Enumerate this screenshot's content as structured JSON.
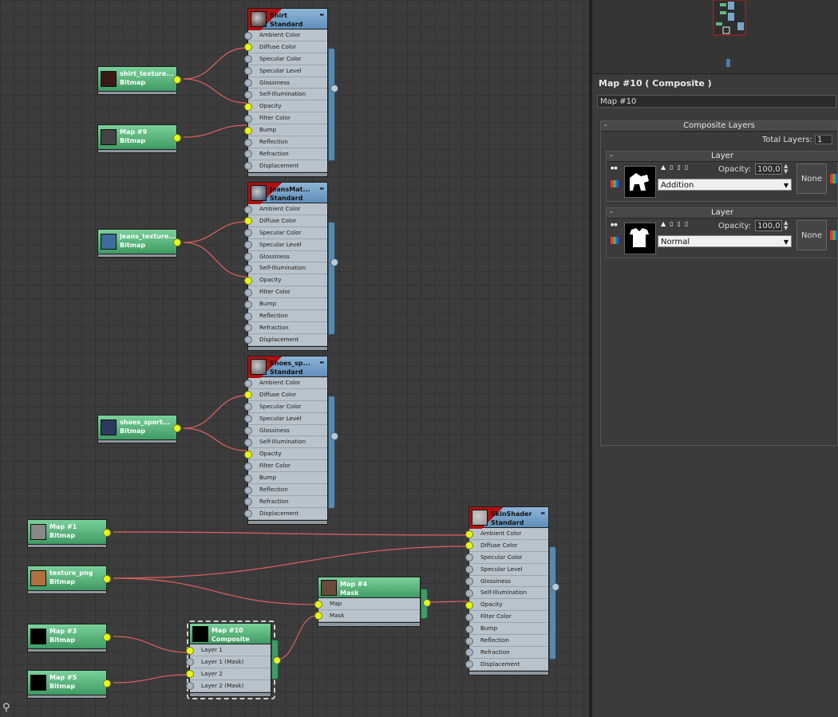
{
  "canvas": {
    "material_nodes": [
      {
        "id": "shirt",
        "name": "Shirt",
        "type": "Standard",
        "slots": [
          "Ambient Color",
          "Diffuse Color",
          "Specular Color",
          "Specular Level",
          "Glossiness",
          "Self-Illumination",
          "Opacity",
          "Filter Color",
          "Bump",
          "Reflection",
          "Refraction",
          "Displacement"
        ],
        "active": [
          1,
          6,
          8
        ]
      },
      {
        "id": "jeans",
        "name": "JeansMat...",
        "type": "Standard",
        "slots": [
          "Ambient Color",
          "Diffuse Color",
          "Specular Color",
          "Specular Level",
          "Glossiness",
          "Self-Illumination",
          "Opacity",
          "Filter Color",
          "Bump",
          "Reflection",
          "Refraction",
          "Displacement"
        ],
        "active": [
          1,
          6
        ]
      },
      {
        "id": "shoes",
        "name": "Shoes_sp...",
        "type": "Standard",
        "slots": [
          "Ambient Color",
          "Diffuse Color",
          "Specular Color",
          "Specular Level",
          "Glossiness",
          "Self-Illumination",
          "Opacity",
          "Filter Color",
          "Bump",
          "Reflection",
          "Refraction",
          "Displacement"
        ],
        "active": [
          1,
          6
        ]
      },
      {
        "id": "skin",
        "name": "SkinShader",
        "type": "Standard",
        "slots": [
          "Ambient Color",
          "Diffuse Color",
          "Specular Color",
          "Specular Level",
          "Glossiness",
          "Self-Illumination",
          "Opacity",
          "Filter Color",
          "Bump",
          "Reflection",
          "Refraction",
          "Displacement"
        ],
        "active": [
          0,
          1,
          6
        ]
      }
    ],
    "map_nodes": [
      {
        "id": "shirt_tex",
        "name": "shirt_texture...",
        "type": "Bitmap"
      },
      {
        "id": "map9",
        "name": "Map #9",
        "type": "Bitmap"
      },
      {
        "id": "jeans_tex",
        "name": "jeans_texture...",
        "type": "Bitmap"
      },
      {
        "id": "shoes_tex",
        "name": "shoes_sport...",
        "type": "Bitmap"
      },
      {
        "id": "map1",
        "name": "Map #1",
        "type": "Bitmap"
      },
      {
        "id": "texture_png",
        "name": "texture_png",
        "type": "Bitmap"
      },
      {
        "id": "map3",
        "name": "Map #3",
        "type": "Bitmap"
      },
      {
        "id": "map5",
        "name": "Map #5",
        "type": "Bitmap"
      }
    ],
    "mask_node": {
      "name": "Map #4",
      "type": "Mask",
      "slots": [
        "Map",
        "Mask"
      ]
    },
    "composite_node": {
      "name": "Map #10",
      "type": "Composite",
      "slots": [
        "Layer 1",
        "Layer 1 (Mask)",
        "Layer 2",
        "Layer 2 (Mask)"
      ]
    }
  },
  "panel": {
    "title": "Map #10  ( Composite )",
    "name_field": "Map #10",
    "rollout_title": "Composite Layers",
    "total_layers_label": "Total Layers:",
    "total_layers_value": "1",
    "layers": [
      {
        "title": "Layer",
        "opacity_label": "Opacity:",
        "opacity": "100,0",
        "blend": "Addition",
        "none_label": "None"
      },
      {
        "title": "Layer",
        "opacity_label": "Opacity:",
        "opacity": "100,0",
        "blend": "Normal",
        "none_label": "None"
      }
    ],
    "collapse_symbol": "-"
  },
  "colors": {
    "wire": "#e06060",
    "material_header": "#7aa6cc",
    "map_header": "#5fb880",
    "socket_active": "#e5f520",
    "title_red": "#b01010"
  }
}
